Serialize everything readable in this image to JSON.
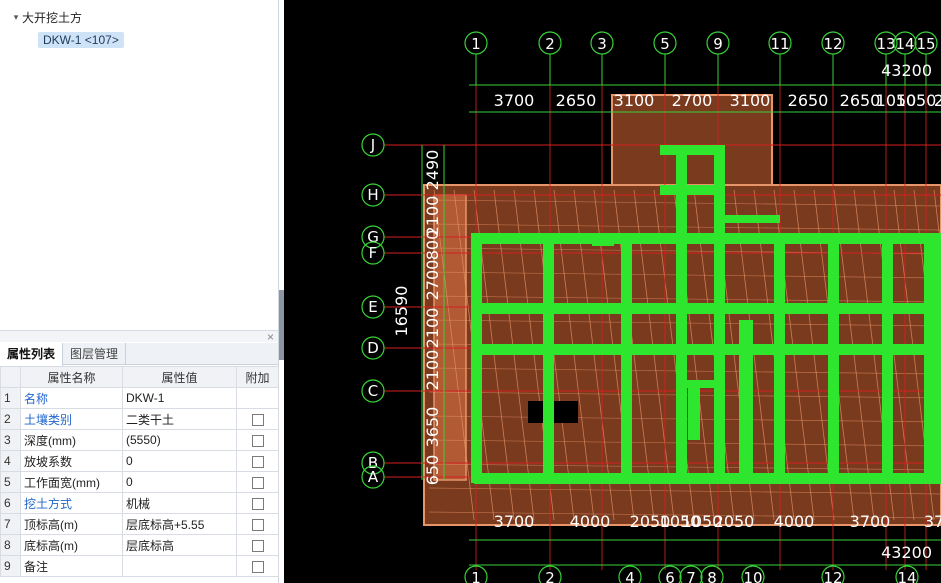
{
  "tree": {
    "root_label": "大开挖土方",
    "child_label": "DKW-1 <107>"
  },
  "panel": {
    "close_glyph": "×"
  },
  "tabs": [
    {
      "label": "属性列表",
      "active": true
    },
    {
      "label": "图层管理",
      "active": false
    }
  ],
  "table": {
    "headers": [
      "",
      "属性名称",
      "属性值",
      "附加"
    ],
    "rows": [
      {
        "idx": "1",
        "name": "名称",
        "value": "DKW-1",
        "blue": true,
        "checkbox": false
      },
      {
        "idx": "2",
        "name": "土壤类别",
        "value": "二类干土",
        "blue": true,
        "checkbox": true
      },
      {
        "idx": "3",
        "name": "深度(mm)",
        "value": "(5550)",
        "blue": false,
        "checkbox": true
      },
      {
        "idx": "4",
        "name": "放坡系数",
        "value": "0",
        "blue": false,
        "checkbox": true
      },
      {
        "idx": "5",
        "name": "工作面宽(mm)",
        "value": "0",
        "blue": false,
        "checkbox": true
      },
      {
        "idx": "6",
        "name": "挖土方式",
        "value": "机械",
        "blue": true,
        "checkbox": true
      },
      {
        "idx": "7",
        "name": "顶标高(m)",
        "value": "层底标高+5.55",
        "blue": false,
        "checkbox": true
      },
      {
        "idx": "8",
        "name": "底标高(m)",
        "value": "层底标高",
        "blue": false,
        "checkbox": true
      },
      {
        "idx": "9",
        "name": "备注",
        "value": "",
        "blue": false,
        "checkbox": true
      }
    ]
  },
  "drawing": {
    "colors": {
      "background": "#000000",
      "excavation": "#7a3a1e",
      "outline": "#e8956a",
      "wall": "#2ee62e",
      "axis": "#39d139",
      "grid": "#d62020",
      "text": "#ffffff"
    },
    "top_axes": [
      "1",
      "2",
      "3",
      "5",
      "9",
      "11",
      "12",
      "13",
      "14",
      "15"
    ],
    "bottom_axes": [
      "1",
      "2",
      "4",
      "6",
      "7",
      "8",
      "10",
      "12",
      "14"
    ],
    "left_axes": [
      "J",
      "H",
      "G",
      "F",
      "E",
      "D",
      "C",
      "B",
      "A"
    ],
    "top_total": "43200",
    "bottom_total": "43200",
    "top_dims": [
      "3700",
      "2650",
      "3100",
      "2700",
      "3100",
      "2650",
      "2650",
      "1050",
      "1050",
      "2"
    ],
    "bottom_dims": [
      "3700",
      "4000",
      "2050",
      "1050",
      "1050",
      "2050",
      "4000",
      "3700",
      "37"
    ],
    "left_dims": [
      "2490",
      "2100",
      "800",
      "2700",
      "2100",
      "2100",
      "3650",
      "650"
    ],
    "left_total": "16590"
  }
}
